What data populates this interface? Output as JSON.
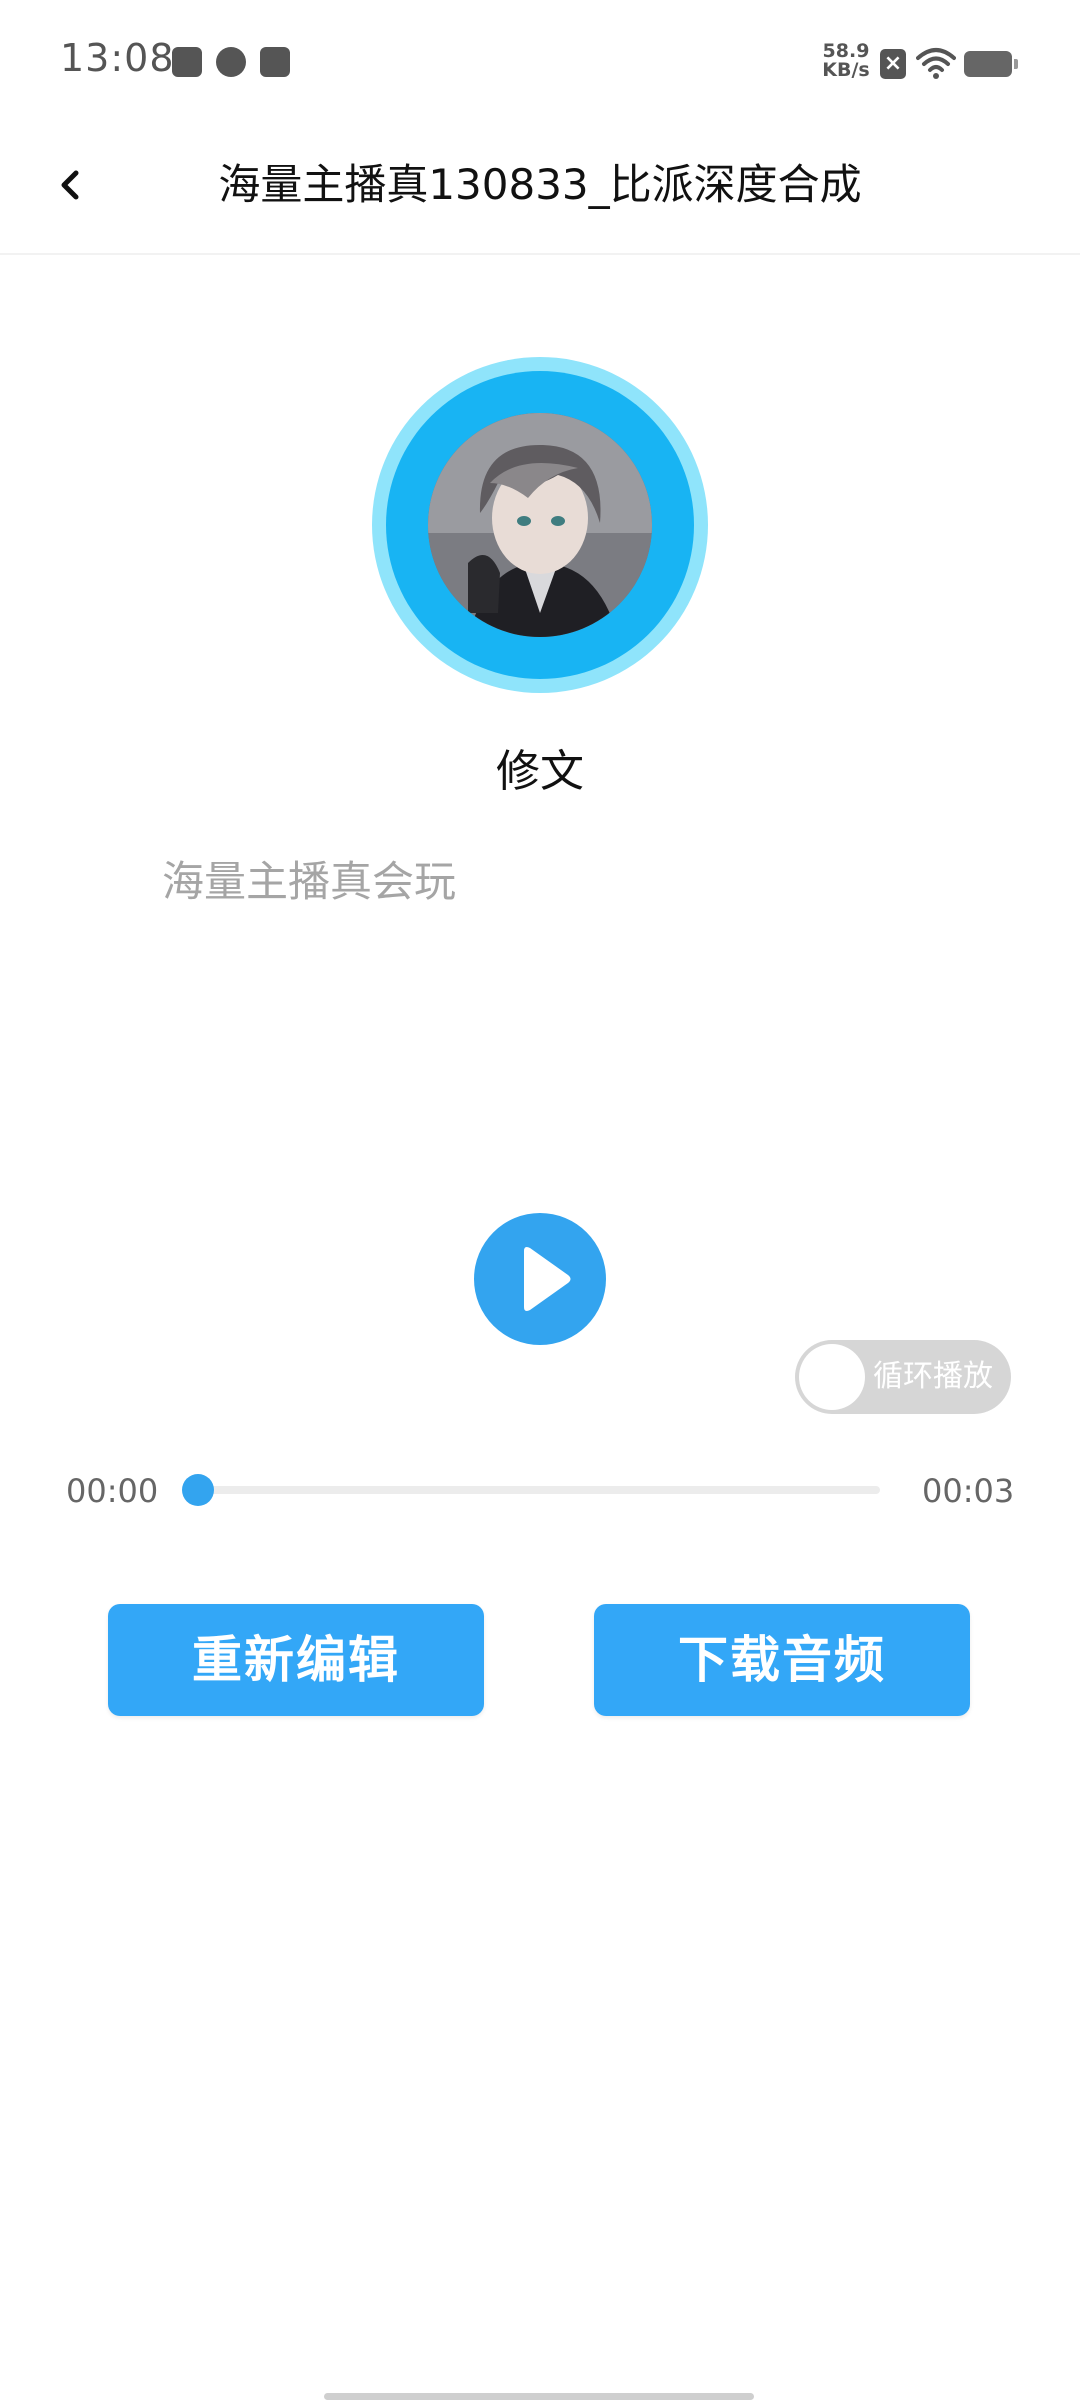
{
  "status_bar": {
    "time": "13:08",
    "net_speed_value": "58.9",
    "net_speed_unit": "KB/s",
    "sim_icon_glyph": "×",
    "icons": [
      "star-notification-icon",
      "link-app-icon",
      "shopping-bag-icon",
      "sim-off-icon",
      "wifi-icon",
      "battery-icon"
    ]
  },
  "header": {
    "title": "海量主播真130833_比派深度合成",
    "back_icon": "chevron-left-icon"
  },
  "voice": {
    "name": "修文",
    "sample_text": "海量主播真会玩"
  },
  "player": {
    "play_icon": "play-icon",
    "loop_label": "循环播放",
    "loop_enabled": false,
    "current_time": "00:00",
    "total_time": "00:03",
    "progress": 0.0
  },
  "actions": {
    "reedit_label": "重新编辑",
    "download_label": "下载音频"
  },
  "colors": {
    "accent": "#33a4ef",
    "avatar_ring_outer": "#8fe4fb",
    "avatar_ring_inner": "#18b4f3",
    "placeholder_text": "#a5a5a5",
    "toggle_off": "#d6d6d6"
  }
}
